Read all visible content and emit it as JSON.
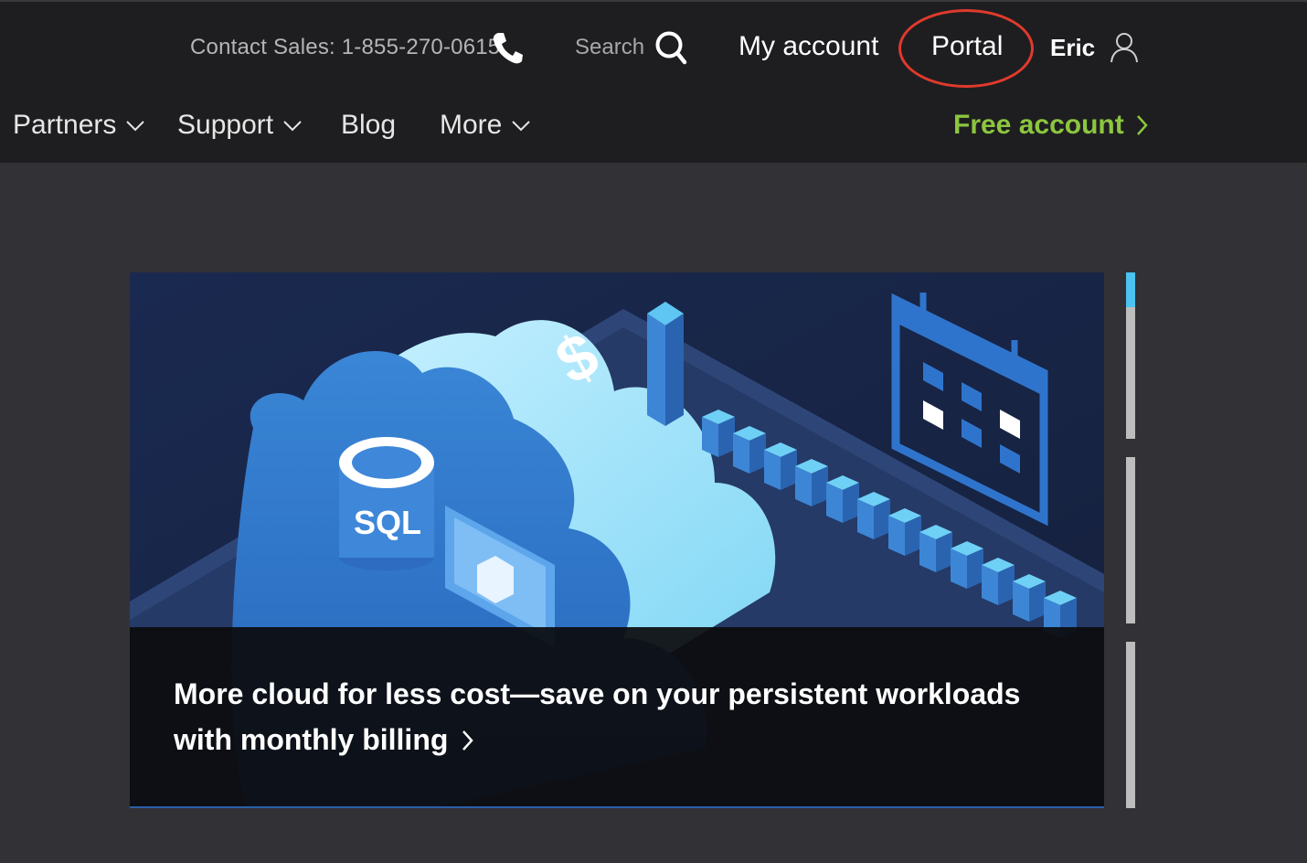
{
  "utility_bar": {
    "contact_sales": "Contact Sales: 1-855-270-0615",
    "phone_icon": "phone-icon",
    "search_label": "Search",
    "search_icon": "search-icon",
    "my_account": "My account",
    "portal": "Portal",
    "user_name": "Eric",
    "user_icon": "user-icon"
  },
  "main_nav": {
    "items": [
      {
        "label": "Partners",
        "has_dropdown": true
      },
      {
        "label": "Support",
        "has_dropdown": true
      },
      {
        "label": "Blog",
        "has_dropdown": false
      },
      {
        "label": "More",
        "has_dropdown": true
      }
    ],
    "free_account": "Free account"
  },
  "hero": {
    "title": "More cloud for less cost—save on your persistent workloads with monthly billing",
    "illustration_text": "SQL",
    "illustration_symbol": "$"
  },
  "carousel": {
    "slides": 3,
    "active_index": 0
  },
  "colors": {
    "header_bg": "#1e1e20",
    "page_bg": "#323135",
    "free_account_green": "#8cc63f",
    "annotation_red": "#e03a2c",
    "indicator_active": "#4cc3f0"
  }
}
